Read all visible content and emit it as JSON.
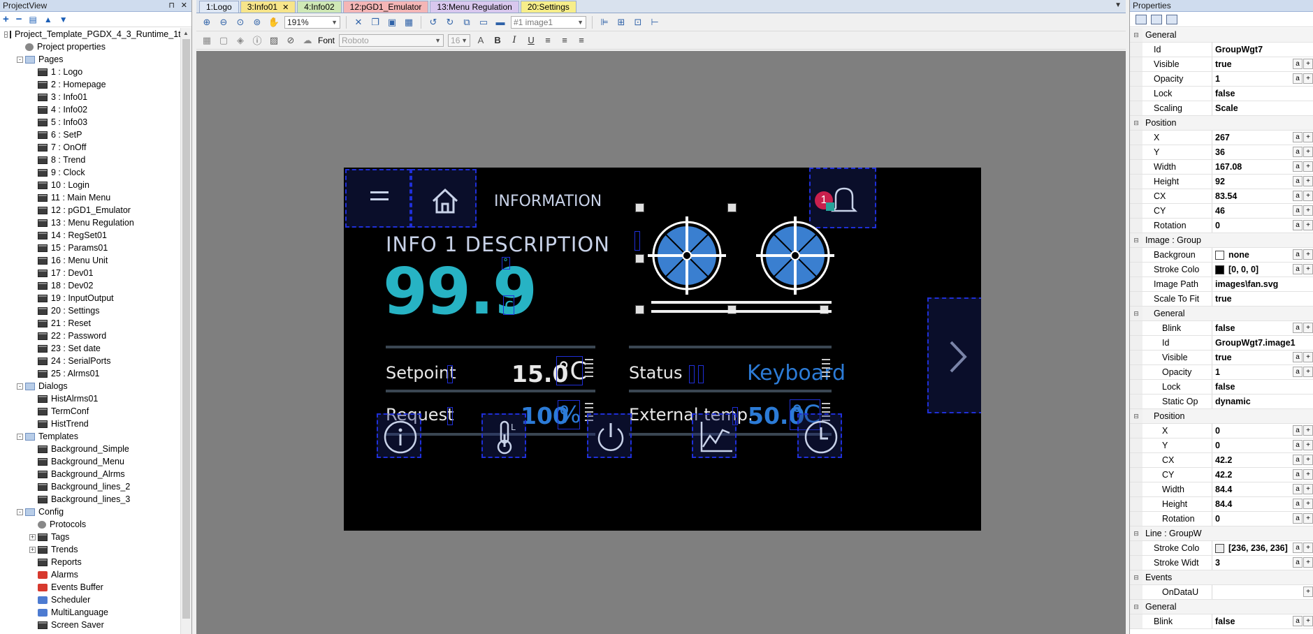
{
  "project_view": {
    "title": "ProjectView",
    "tree": [
      {
        "label": "Project_Template_PGDX_4_3_Runtime_1t",
        "level": 0,
        "exp": "-",
        "icon": "page"
      },
      {
        "label": "Project properties",
        "level": 1,
        "exp": "",
        "icon": "gear"
      },
      {
        "label": "Pages",
        "level": 1,
        "exp": "-",
        "icon": "folder"
      },
      {
        "label": "1 : Logo",
        "level": 2,
        "exp": "",
        "icon": "page"
      },
      {
        "label": "2 : Homepage",
        "level": 2,
        "exp": "",
        "icon": "page"
      },
      {
        "label": "3 : Info01",
        "level": 2,
        "exp": "",
        "icon": "page"
      },
      {
        "label": "4 : Info02",
        "level": 2,
        "exp": "",
        "icon": "page"
      },
      {
        "label": "5 : Info03",
        "level": 2,
        "exp": "",
        "icon": "page"
      },
      {
        "label": "6 : SetP",
        "level": 2,
        "exp": "",
        "icon": "page"
      },
      {
        "label": "7 : OnOff",
        "level": 2,
        "exp": "",
        "icon": "page"
      },
      {
        "label": "8 : Trend",
        "level": 2,
        "exp": "",
        "icon": "page"
      },
      {
        "label": "9 : Clock",
        "level": 2,
        "exp": "",
        "icon": "page"
      },
      {
        "label": "10 : Login",
        "level": 2,
        "exp": "",
        "icon": "page"
      },
      {
        "label": "11 : Main Menu",
        "level": 2,
        "exp": "",
        "icon": "page"
      },
      {
        "label": "12 : pGD1_Emulator",
        "level": 2,
        "exp": "",
        "icon": "page"
      },
      {
        "label": "13 : Menu Regulation",
        "level": 2,
        "exp": "",
        "icon": "page"
      },
      {
        "label": "14 : RegSet01",
        "level": 2,
        "exp": "",
        "icon": "page"
      },
      {
        "label": "15 : Params01",
        "level": 2,
        "exp": "",
        "icon": "page"
      },
      {
        "label": "16 : Menu Unit",
        "level": 2,
        "exp": "",
        "icon": "page"
      },
      {
        "label": "17 : Dev01",
        "level": 2,
        "exp": "",
        "icon": "page"
      },
      {
        "label": "18 : Dev02",
        "level": 2,
        "exp": "",
        "icon": "page"
      },
      {
        "label": "19 : InputOutput",
        "level": 2,
        "exp": "",
        "icon": "page"
      },
      {
        "label": "20 : Settings",
        "level": 2,
        "exp": "",
        "icon": "page"
      },
      {
        "label": "21 : Reset",
        "level": 2,
        "exp": "",
        "icon": "page"
      },
      {
        "label": "22 : Password",
        "level": 2,
        "exp": "",
        "icon": "page"
      },
      {
        "label": "23 : Set date",
        "level": 2,
        "exp": "",
        "icon": "page"
      },
      {
        "label": "24 : SerialPorts",
        "level": 2,
        "exp": "",
        "icon": "page"
      },
      {
        "label": "25 : Alrms01",
        "level": 2,
        "exp": "",
        "icon": "page"
      },
      {
        "label": "Dialogs",
        "level": 1,
        "exp": "-",
        "icon": "folder"
      },
      {
        "label": "HistAlrms01",
        "level": 2,
        "exp": "",
        "icon": "page"
      },
      {
        "label": "TermConf",
        "level": 2,
        "exp": "",
        "icon": "page"
      },
      {
        "label": "HistTrend",
        "level": 2,
        "exp": "",
        "icon": "page"
      },
      {
        "label": "Templates",
        "level": 1,
        "exp": "-",
        "icon": "folder"
      },
      {
        "label": "Background_Simple",
        "level": 2,
        "exp": "",
        "icon": "page"
      },
      {
        "label": "Background_Menu",
        "level": 2,
        "exp": "",
        "icon": "page"
      },
      {
        "label": "Background_Alrms",
        "level": 2,
        "exp": "",
        "icon": "page"
      },
      {
        "label": "Background_lines_2",
        "level": 2,
        "exp": "",
        "icon": "page"
      },
      {
        "label": "Background_lines_3",
        "level": 2,
        "exp": "",
        "icon": "page"
      },
      {
        "label": "Config",
        "level": 1,
        "exp": "-",
        "icon": "folder"
      },
      {
        "label": "Protocols",
        "level": 2,
        "exp": "",
        "icon": "gear"
      },
      {
        "label": "Tags",
        "level": 2,
        "exp": "+",
        "icon": "page"
      },
      {
        "label": "Trends",
        "level": 2,
        "exp": "+",
        "icon": "page"
      },
      {
        "label": "Reports",
        "level": 2,
        "exp": "",
        "icon": "page"
      },
      {
        "label": "Alarms",
        "level": 2,
        "exp": "",
        "icon": "red"
      },
      {
        "label": "Events Buffer",
        "level": 2,
        "exp": "",
        "icon": "red"
      },
      {
        "label": "Scheduler",
        "level": 2,
        "exp": "",
        "icon": "blue"
      },
      {
        "label": "MultiLanguage",
        "level": 2,
        "exp": "",
        "icon": "blue"
      },
      {
        "label": "Screen Saver",
        "level": 2,
        "exp": "",
        "icon": "page"
      }
    ]
  },
  "tabs": [
    {
      "label": "1:Logo",
      "color": "#dfe8f5",
      "active": false
    },
    {
      "label": "3:Info01",
      "color": "#f7e58a",
      "active": true
    },
    {
      "label": "4:Info02",
      "color": "#cfe8b5",
      "active": false
    },
    {
      "label": "12:pGD1_Emulator",
      "color": "#f4b6b6",
      "active": false
    },
    {
      "label": "13:Menu Regulation",
      "color": "#d9c8ee",
      "active": false
    },
    {
      "label": "20:Settings",
      "color": "#f7ee8a",
      "active": false
    }
  ],
  "toolbar": {
    "zoom": "191%",
    "object_select": "#1 image1",
    "font_label": "Font",
    "font_family": "Roboto",
    "font_size": "16"
  },
  "hmi": {
    "title": "INFORMATION",
    "description": "INFO 1 DESCRIPTION",
    "main_value": "99.9",
    "main_unit_deg": "°",
    "main_unit_c": "c",
    "alarm_count": "1",
    "setpoint_label": "Setpoint",
    "setpoint_value": "15.0",
    "setpoint_unit": "°C",
    "status_label": "Status",
    "status_value": "Keyboard",
    "request_label": "Request",
    "request_value": "100",
    "request_unit": "%",
    "ext_label": "External temp.",
    "ext_value": "50.0",
    "ext_unit": "°C"
  },
  "properties": {
    "title": "Properties",
    "rows": [
      {
        "type": "cat",
        "name": "General"
      },
      {
        "type": "prop",
        "indent": 1,
        "name": "Id",
        "value": "GroupWgt7",
        "btns": false
      },
      {
        "type": "prop",
        "indent": 1,
        "name": "Visible",
        "value": "true",
        "btns": true
      },
      {
        "type": "prop",
        "indent": 1,
        "name": "Opacity",
        "value": "1",
        "btns": true
      },
      {
        "type": "prop",
        "indent": 1,
        "name": "Lock",
        "value": "false",
        "btns": false
      },
      {
        "type": "prop",
        "indent": 1,
        "name": "Scaling",
        "value": "Scale",
        "btns": false
      },
      {
        "type": "cat",
        "name": "Position"
      },
      {
        "type": "prop",
        "indent": 1,
        "name": "X",
        "value": "267",
        "btns": true
      },
      {
        "type": "prop",
        "indent": 1,
        "name": "Y",
        "value": "36",
        "btns": true
      },
      {
        "type": "prop",
        "indent": 1,
        "name": "Width",
        "value": "167.08",
        "btns": true
      },
      {
        "type": "prop",
        "indent": 1,
        "name": "Height",
        "value": "92",
        "btns": true
      },
      {
        "type": "prop",
        "indent": 1,
        "name": "CX",
        "value": "83.54",
        "btns": true
      },
      {
        "type": "prop",
        "indent": 1,
        "name": "CY",
        "value": "46",
        "btns": true
      },
      {
        "type": "prop",
        "indent": 1,
        "name": "Rotation",
        "value": "0",
        "btns": true
      },
      {
        "type": "cat",
        "name": "Image : Group"
      },
      {
        "type": "prop",
        "indent": 1,
        "name": "Backgroun",
        "value": "none",
        "swatch": "#ffffff",
        "btns": true
      },
      {
        "type": "prop",
        "indent": 1,
        "name": "Stroke Colo",
        "value": "[0, 0, 0]",
        "swatch": "#000000",
        "btns": true
      },
      {
        "type": "prop",
        "indent": 1,
        "name": "Image Path",
        "value": "images\\fan.svg",
        "btns": false
      },
      {
        "type": "prop",
        "indent": 1,
        "name": "Scale To Fit",
        "value": "true",
        "btns": false
      },
      {
        "type": "cat",
        "name": "General",
        "indent": 1
      },
      {
        "type": "prop",
        "indent": 2,
        "name": "Blink",
        "value": "false",
        "btns": true
      },
      {
        "type": "prop",
        "indent": 2,
        "name": "Id",
        "value": "GroupWgt7.image1",
        "btns": false
      },
      {
        "type": "prop",
        "indent": 2,
        "name": "Visible",
        "value": "true",
        "btns": true
      },
      {
        "type": "prop",
        "indent": 2,
        "name": "Opacity",
        "value": "1",
        "btns": true
      },
      {
        "type": "prop",
        "indent": 2,
        "name": "Lock",
        "value": "false",
        "btns": false
      },
      {
        "type": "prop",
        "indent": 2,
        "name": "Static Op",
        "value": "dynamic",
        "btns": false
      },
      {
        "type": "cat",
        "name": "Position",
        "indent": 1
      },
      {
        "type": "prop",
        "indent": 2,
        "name": "X",
        "value": "0",
        "btns": true
      },
      {
        "type": "prop",
        "indent": 2,
        "name": "Y",
        "value": "0",
        "btns": true
      },
      {
        "type": "prop",
        "indent": 2,
        "name": "CX",
        "value": "42.2",
        "btns": true
      },
      {
        "type": "prop",
        "indent": 2,
        "name": "CY",
        "value": "42.2",
        "btns": true
      },
      {
        "type": "prop",
        "indent": 2,
        "name": "Width",
        "value": "84.4",
        "btns": true
      },
      {
        "type": "prop",
        "indent": 2,
        "name": "Height",
        "value": "84.4",
        "btns": true
      },
      {
        "type": "prop",
        "indent": 2,
        "name": "Rotation",
        "value": "0",
        "btns": true
      },
      {
        "type": "cat",
        "name": "Line : GroupW"
      },
      {
        "type": "prop",
        "indent": 1,
        "name": "Stroke Colo",
        "value": "[236, 236, 236]",
        "swatch": "#ececec",
        "btns": true
      },
      {
        "type": "prop",
        "indent": 1,
        "name": "Stroke Widt",
        "value": "3",
        "btns": true
      },
      {
        "type": "cat",
        "name": "Events"
      },
      {
        "type": "prop",
        "indent": 2,
        "name": "OnDataU",
        "value": "",
        "btns": "plus"
      },
      {
        "type": "cat",
        "name": "General"
      },
      {
        "type": "prop",
        "indent": 1,
        "name": "Blink",
        "value": "false",
        "btns": true
      }
    ]
  },
  "colors": {
    "hmi_accent_blue": "#2c7bd6",
    "hmi_teal": "#27b3c4",
    "selection_blue": "#1f2fd8"
  }
}
